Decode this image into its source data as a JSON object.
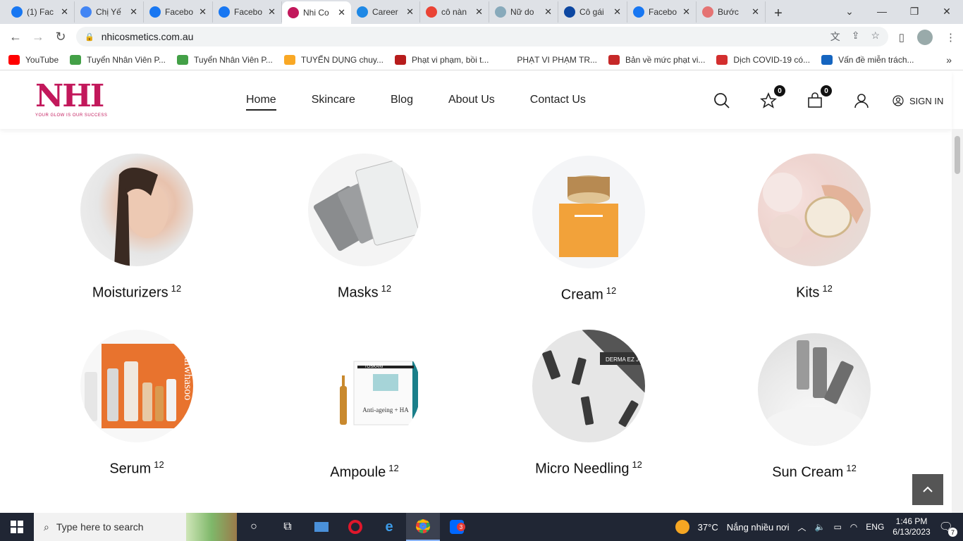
{
  "browser": {
    "tabs": [
      {
        "title": "(1) Fac",
        "icon": "facebook-icon",
        "color": "#1877f2"
      },
      {
        "title": "Chị Yế",
        "icon": "docs-icon",
        "color": "#4285f4"
      },
      {
        "title": "Facebo",
        "icon": "facebook-icon",
        "color": "#1877f2"
      },
      {
        "title": "Facebo",
        "icon": "facebook-icon",
        "color": "#1877f2"
      },
      {
        "title": "Nhi Co",
        "icon": "nhi-logo-icon",
        "color": "#c2185b",
        "active": true
      },
      {
        "title": "Career",
        "icon": "career-icon",
        "color": "#1e88e5"
      },
      {
        "title": "cô nàn",
        "icon": "google-icon",
        "color": "#ea4335"
      },
      {
        "title": "Nữ do",
        "icon": "site-icon",
        "color": "#8ab"
      },
      {
        "title": "Cô gái",
        "icon": "tn-icon",
        "color": "#0d47a1"
      },
      {
        "title": "Facebo",
        "icon": "facebook-icon",
        "color": "#1877f2"
      },
      {
        "title": "Bước",
        "icon": "site-icon",
        "color": "#e57373"
      }
    ],
    "url": "nhicosmetics.com.au",
    "bookmarks": [
      {
        "label": "YouTube",
        "color": "#ff0000"
      },
      {
        "label": "Tuyển Nhân Viên P...",
        "color": "#43a047"
      },
      {
        "label": "Tuyển Nhân Viên P...",
        "color": "#43a047"
      },
      {
        "label": "TUYỂN DỤNG chuy...",
        "color": "#f9a825"
      },
      {
        "label": "Phạt vi phạm, bồi t...",
        "color": "#b71c1c"
      },
      {
        "label": "PHẠT VI PHẠM TR...",
        "color": "#ffffff"
      },
      {
        "label": "Bản về mức phạt vi...",
        "color": "#c62828"
      },
      {
        "label": "Dịch COVID-19 có...",
        "color": "#d32f2f"
      },
      {
        "label": "Vấn đề miễn trách...",
        "color": "#1565c0"
      }
    ]
  },
  "site": {
    "logo_text": "NHI",
    "logo_tagline": "YOUR GLOW IS OUR SUCCESS",
    "nav": [
      "Home",
      "Skincare",
      "Blog",
      "About Us",
      "Contact Us"
    ],
    "wishlist_count": "0",
    "cart_count": "0",
    "signin_label": "SIGN IN"
  },
  "categories": [
    {
      "name": "Moisturizers",
      "count": "12"
    },
    {
      "name": "Masks",
      "count": "12"
    },
    {
      "name": "Cream",
      "count": "12"
    },
    {
      "name": "Kits",
      "count": "12"
    },
    {
      "name": "Serum",
      "count": "12"
    },
    {
      "name": "Ampoule",
      "count": "12"
    },
    {
      "name": "Micro Needling",
      "count": "12"
    },
    {
      "name": "Sun Cream",
      "count": "12"
    }
  ],
  "product_text": {
    "ampoule_box": "Anti-ageing + HA",
    "ampoule_brand": "TOSKANI",
    "micro_brand": "DERMA EZ JET",
    "serum_brand": "Sulwhasoo"
  },
  "taskbar": {
    "search_placeholder": "Type here to search",
    "weather_temp": "37°C",
    "weather_text": "Nắng nhiều nơi",
    "lang": "ENG",
    "time": "1:46 PM",
    "date": "6/13/2023",
    "notif_count": "7",
    "zalo_badge": "3"
  }
}
